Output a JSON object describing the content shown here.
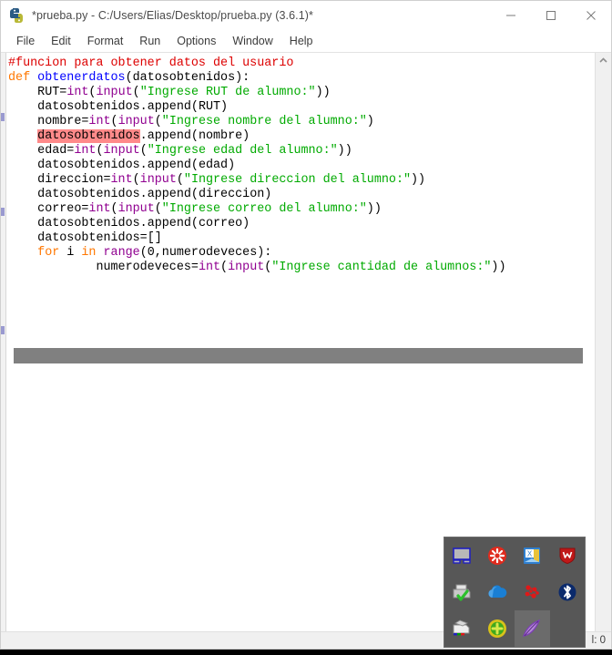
{
  "window": {
    "title": "*prueba.py - C:/Users/Elias/Desktop/prueba.py (3.6.1)*",
    "app_icon": "python-idle-icon",
    "controls": {
      "minimize": "minimize-icon",
      "maximize": "maximize-icon",
      "close": "close-icon"
    }
  },
  "menu": {
    "items": [
      {
        "label": "File"
      },
      {
        "label": "Edit"
      },
      {
        "label": "Format"
      },
      {
        "label": "Run"
      },
      {
        "label": "Options"
      },
      {
        "label": "Window"
      },
      {
        "label": "Help"
      }
    ]
  },
  "editor": {
    "lines": [
      {
        "indent": 0,
        "tokens": [
          {
            "t": "#funcion para obtener datos del usuario",
            "c": "comment"
          }
        ]
      },
      {
        "indent": 0,
        "tokens": [
          {
            "t": "def ",
            "c": "kw"
          },
          {
            "t": "obtenerdatos",
            "c": "def"
          },
          {
            "t": "(datosobtenidos):",
            "c": "plain"
          }
        ]
      },
      {
        "indent": 1,
        "tokens": [
          {
            "t": "RUT=",
            "c": "plain"
          },
          {
            "t": "int",
            "c": "builtin"
          },
          {
            "t": "(",
            "c": "plain"
          },
          {
            "t": "input",
            "c": "builtin"
          },
          {
            "t": "(",
            "c": "plain"
          },
          {
            "t": "\"Ingrese RUT de alumno:\"",
            "c": "str"
          },
          {
            "t": "))",
            "c": "plain"
          }
        ]
      },
      {
        "indent": 1,
        "tokens": [
          {
            "t": "datosobtenidos.append(RUT)",
            "c": "plain"
          }
        ]
      },
      {
        "indent": 1,
        "tokens": [
          {
            "t": "nombre=",
            "c": "plain"
          },
          {
            "t": "int",
            "c": "builtin"
          },
          {
            "t": "(",
            "c": "plain"
          },
          {
            "t": "input",
            "c": "builtin"
          },
          {
            "t": "(",
            "c": "plain"
          },
          {
            "t": "\"Ingrese nombre del alumno:\"",
            "c": "str"
          },
          {
            "t": ")",
            "c": "plain"
          }
        ]
      },
      {
        "indent": 1,
        "tokens": [
          {
            "t": "datosobtenidos",
            "c": "sel"
          },
          {
            "t": ".append(nombre)",
            "c": "plain"
          }
        ]
      },
      {
        "indent": 1,
        "tokens": [
          {
            "t": "edad=",
            "c": "plain"
          },
          {
            "t": "int",
            "c": "builtin"
          },
          {
            "t": "(",
            "c": "plain"
          },
          {
            "t": "input",
            "c": "builtin"
          },
          {
            "t": "(",
            "c": "plain"
          },
          {
            "t": "\"Ingrese edad del alumno:\"",
            "c": "str"
          },
          {
            "t": "))",
            "c": "plain"
          }
        ]
      },
      {
        "indent": 1,
        "tokens": [
          {
            "t": "datosobtenidos.append(edad)",
            "c": "plain"
          }
        ]
      },
      {
        "indent": 1,
        "tokens": [
          {
            "t": "direccion=",
            "c": "plain"
          },
          {
            "t": "int",
            "c": "builtin"
          },
          {
            "t": "(",
            "c": "plain"
          },
          {
            "t": "input",
            "c": "builtin"
          },
          {
            "t": "(",
            "c": "plain"
          },
          {
            "t": "\"Ingrese direccion del alumno:\"",
            "c": "str"
          },
          {
            "t": "))",
            "c": "plain"
          }
        ]
      },
      {
        "indent": 1,
        "tokens": [
          {
            "t": "datosobtenidos.append(direccion)",
            "c": "plain"
          }
        ]
      },
      {
        "indent": 1,
        "tokens": [
          {
            "t": "correo=",
            "c": "plain"
          },
          {
            "t": "int",
            "c": "builtin"
          },
          {
            "t": "(",
            "c": "plain"
          },
          {
            "t": "input",
            "c": "builtin"
          },
          {
            "t": "(",
            "c": "plain"
          },
          {
            "t": "\"Ingrese correo del alumno:\"",
            "c": "str"
          },
          {
            "t": "))",
            "c": "plain"
          }
        ]
      },
      {
        "indent": 1,
        "tokens": [
          {
            "t": "datosobtenidos.append(correo)",
            "c": "plain"
          }
        ]
      },
      {
        "indent": 1,
        "tokens": [
          {
            "t": "datosobtenidos=[]",
            "c": "plain"
          }
        ]
      },
      {
        "indent": 1,
        "tokens": [
          {
            "t": "for",
            "c": "kw"
          },
          {
            "t": " i ",
            "c": "plain"
          },
          {
            "t": "in",
            "c": "kw"
          },
          {
            "t": " ",
            "c": "plain"
          },
          {
            "t": "range",
            "c": "builtin"
          },
          {
            "t": "(0,numerodeveces):",
            "c": "plain"
          }
        ]
      },
      {
        "indent": 3,
        "tokens": [
          {
            "t": "numerodeveces=",
            "c": "plain"
          },
          {
            "t": "int",
            "c": "builtin"
          },
          {
            "t": "(",
            "c": "plain"
          },
          {
            "t": "input",
            "c": "builtin"
          },
          {
            "t": "(",
            "c": "plain"
          },
          {
            "t": "\"Ingrese cantidad de alumnos:\"",
            "c": "str"
          },
          {
            "t": "))",
            "c": "plain"
          }
        ]
      }
    ],
    "selection_highlight_color": "#ff8a8a",
    "gray_bar_color": "#808080"
  },
  "statusbar": {
    "text": "l: 0"
  },
  "tray": {
    "icons": [
      {
        "name": "display-monitor-icon",
        "active": false
      },
      {
        "name": "red-asterisk-icon",
        "active": false
      },
      {
        "name": "office-document-icon",
        "active": false
      },
      {
        "name": "mcafee-shield-icon",
        "active": false
      },
      {
        "name": "printer-ready-icon",
        "active": false
      },
      {
        "name": "onedrive-cloud-icon",
        "active": false
      },
      {
        "name": "red-molecule-icon",
        "active": false
      },
      {
        "name": "bluetooth-icon",
        "active": false
      },
      {
        "name": "color-printer-icon",
        "active": false
      },
      {
        "name": "green-plus-icon",
        "active": false
      },
      {
        "name": "purple-feather-icon",
        "active": true
      },
      {
        "name": "empty-slot",
        "active": false
      }
    ]
  },
  "colors": {
    "comment": "#dd0000",
    "keyword": "#ff7700",
    "definition": "#0000ff",
    "builtin": "#900090",
    "string": "#00aa00",
    "tray_background": "#575757"
  }
}
